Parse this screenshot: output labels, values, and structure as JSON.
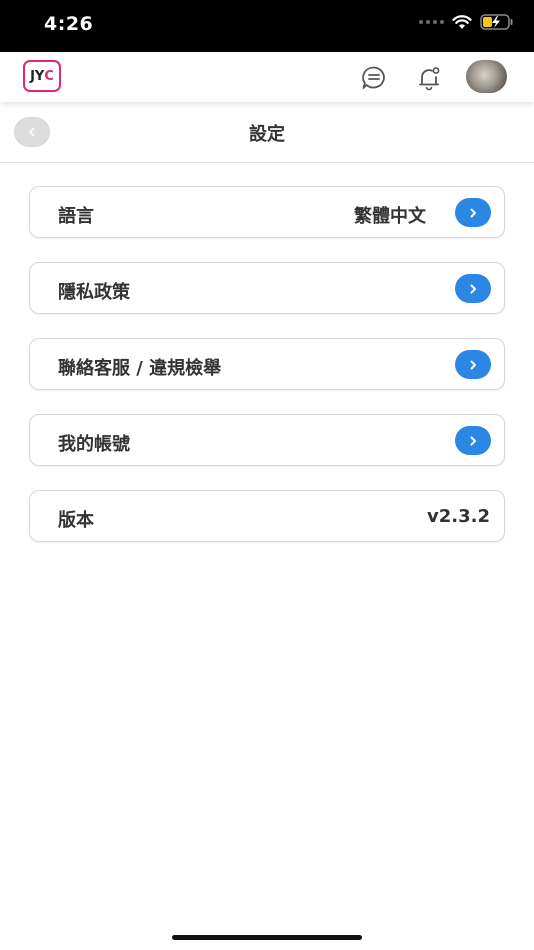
{
  "status_bar": {
    "time": "4:26"
  },
  "header": {
    "logo_text_1": "JY",
    "logo_text_2": "C",
    "brand_color": "#e0287a",
    "icons": [
      "chat-icon",
      "bell-icon",
      "avatar"
    ]
  },
  "nav": {
    "title": "設定"
  },
  "settings": {
    "items": [
      {
        "label": "語言",
        "value": "繁體中文"
      },
      {
        "label": "隱私政策"
      },
      {
        "label": "聯絡客服 / 違規檢舉"
      },
      {
        "label": "我的帳號"
      },
      {
        "label": "版本",
        "value": "v2.3.2"
      }
    ]
  },
  "colors": {
    "accent": "#2b86e4",
    "text": "#333333",
    "border": "#d6d6d6"
  }
}
